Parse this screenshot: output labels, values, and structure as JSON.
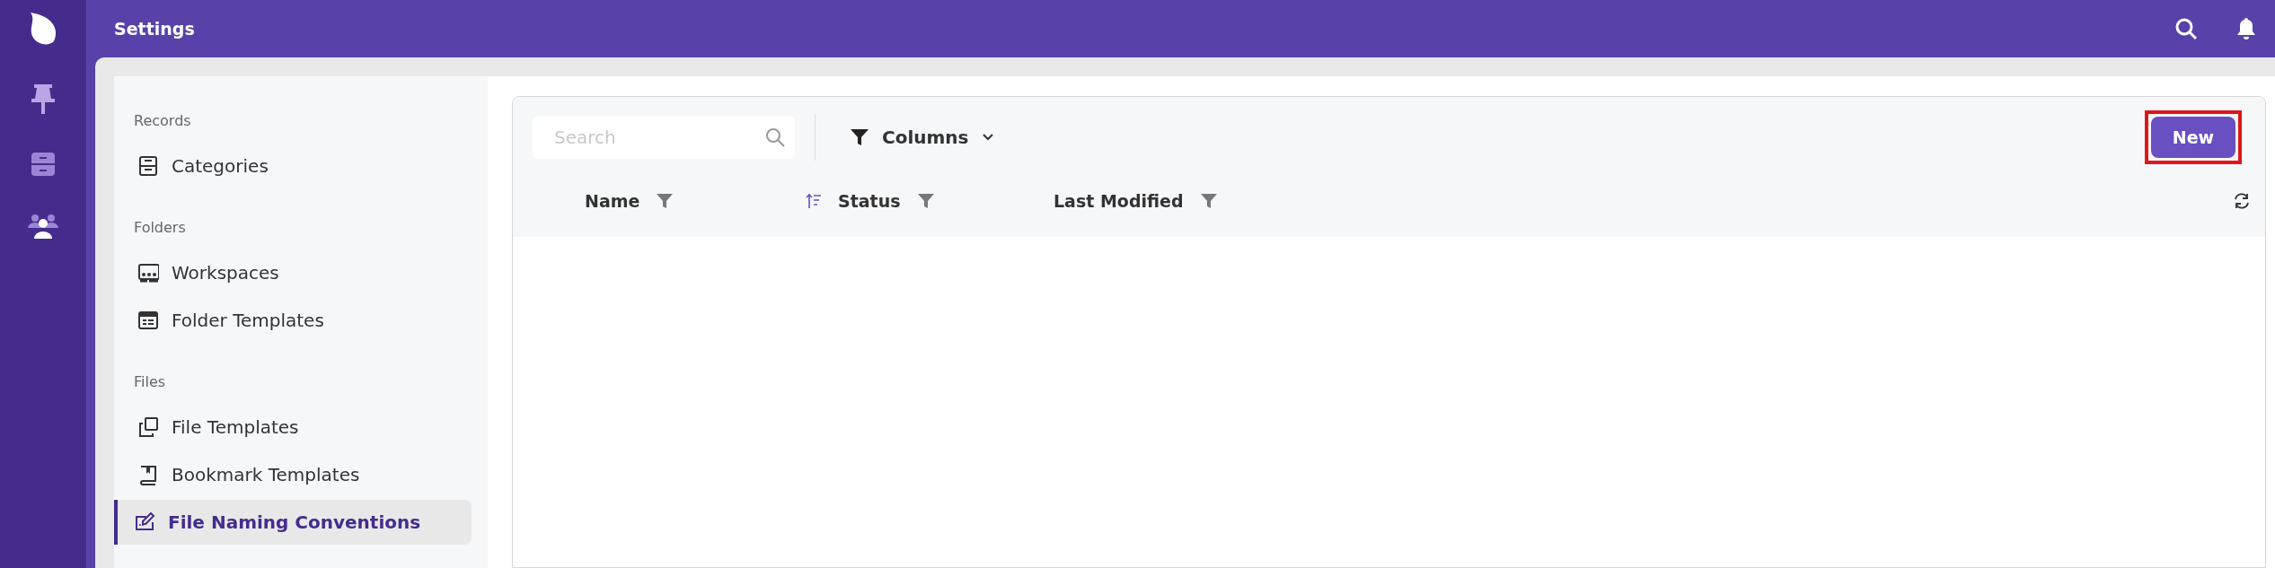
{
  "header": {
    "title": "Settings"
  },
  "sidebar": {
    "sections": [
      {
        "heading": "Records",
        "items": [
          {
            "label": "Categories",
            "selected": false
          }
        ]
      },
      {
        "heading": "Folders",
        "items": [
          {
            "label": "Workspaces",
            "selected": false
          },
          {
            "label": "Folder Templates",
            "selected": false
          }
        ]
      },
      {
        "heading": "Files",
        "items": [
          {
            "label": "File Templates",
            "selected": false
          },
          {
            "label": "Bookmark Templates",
            "selected": false
          },
          {
            "label": "File Naming Conventions",
            "selected": true
          }
        ]
      }
    ]
  },
  "toolbar": {
    "search": {
      "placeholder": "Search"
    },
    "columns_button": "Columns",
    "new_button": {
      "label": "New",
      "highlighted": true
    }
  },
  "table": {
    "columns": [
      {
        "label": "Name",
        "sorted": false
      },
      {
        "label": "Status",
        "sorted": true
      },
      {
        "label": "Last Modified",
        "sorted": false
      }
    ]
  }
}
